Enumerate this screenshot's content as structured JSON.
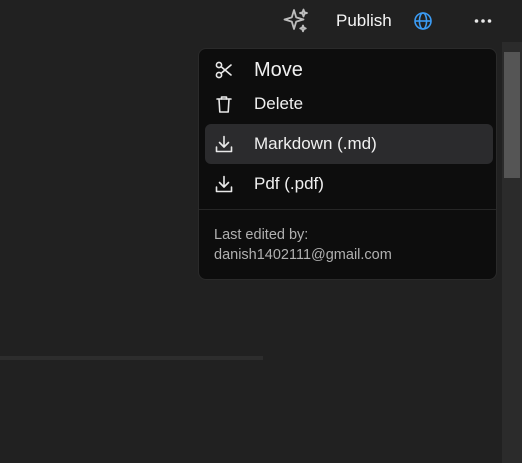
{
  "topbar": {
    "ai_icon": "sparkle-icon",
    "publish_label": "Publish",
    "globe_icon": "globe-icon",
    "more_icon": "more-horizontal-icon",
    "accent_color": "#3b9cf5"
  },
  "menu": {
    "items": [
      {
        "label": "Move",
        "icon": "scissors-icon"
      },
      {
        "label": "Delete",
        "icon": "trash-icon"
      },
      {
        "label": "Markdown (.md)",
        "icon": "download-icon"
      },
      {
        "label": "Pdf (.pdf)",
        "icon": "download-icon"
      }
    ],
    "last_edited_label": "Last edited by:",
    "last_edited_user": "danish1402111@gmail.com"
  }
}
